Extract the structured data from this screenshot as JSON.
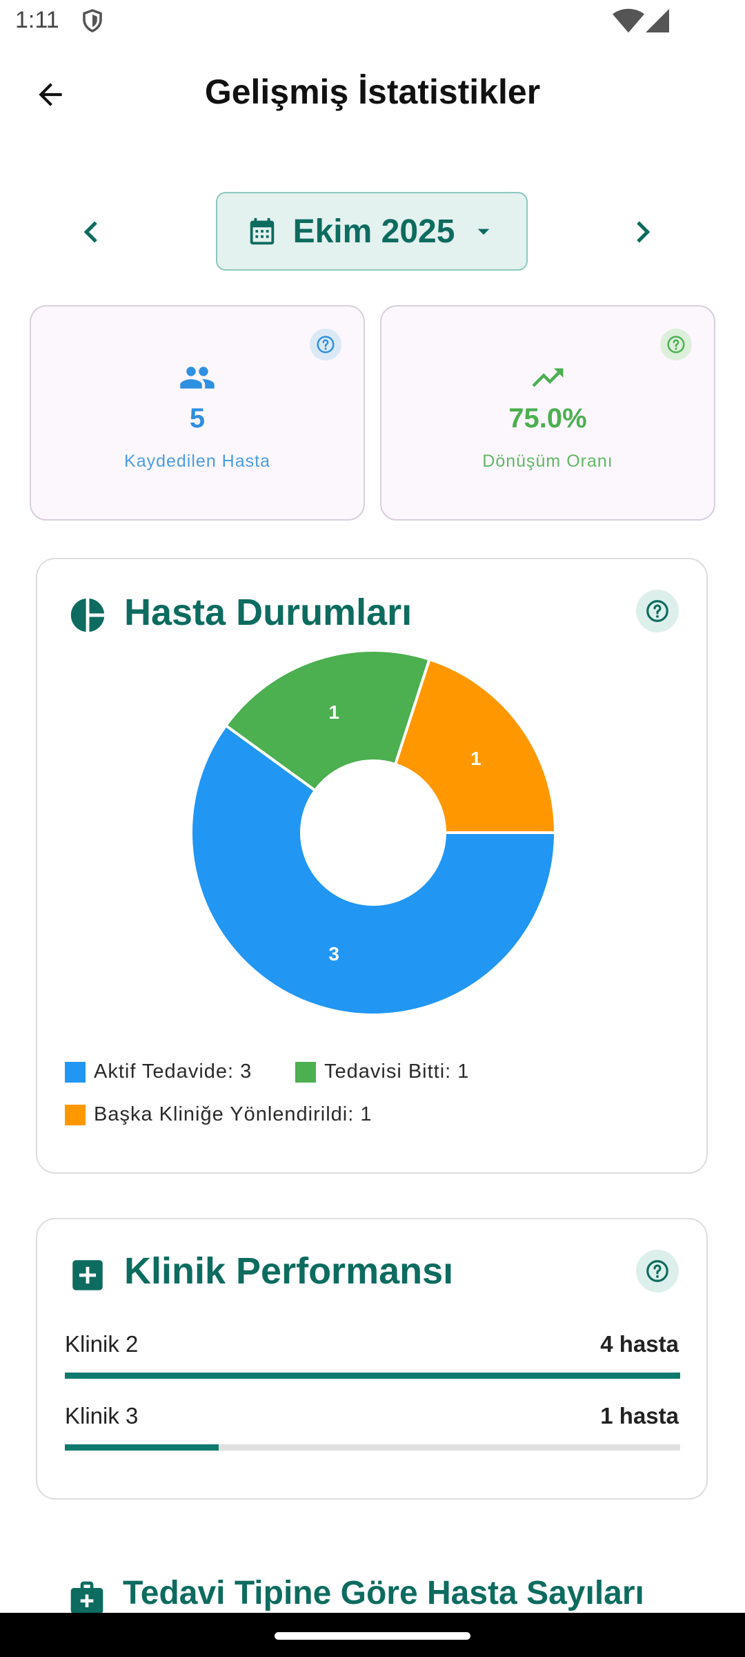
{
  "status_bar": {
    "time": "1:11"
  },
  "header": {
    "title": "Gelişmiş İstatistikler"
  },
  "month_selector": {
    "label": "Ekim 2025"
  },
  "stats": [
    {
      "value": "5",
      "label": "Kaydedilen Hasta",
      "color": "#2f8fe0"
    },
    {
      "value": "75.0%",
      "label": "Dönüşüm Oranı",
      "color": "#4caf50"
    }
  ],
  "status_section": {
    "title": "Hasta Durumları",
    "chart_data": {
      "type": "pie",
      "categories": [
        "Aktif Tedavide",
        "Tedavisi Bitti",
        "Başka Kliniğe Yönlendirildi"
      ],
      "values": [
        3,
        1,
        1
      ],
      "colors": [
        "#2196f3",
        "#4caf50",
        "#ff9800"
      ]
    },
    "legend": [
      {
        "label": "Aktif Tedavide: 3",
        "color": "#2196f3"
      },
      {
        "label": "Tedavisi Bitti: 1",
        "color": "#4caf50"
      },
      {
        "label": "Başka Kliniğe Yönlendirildi: 1",
        "color": "#ff9800"
      }
    ]
  },
  "clinic_section": {
    "title": "Klinik Performansı",
    "rows": [
      {
        "name": "Klinik 2",
        "value": "4 hasta",
        "fraction": 1.0
      },
      {
        "name": "Klinik 3",
        "value": "1 hasta",
        "fraction": 0.25
      }
    ]
  },
  "treatment_section": {
    "title": "Tedavi Tipine Göre Hasta Sayıları"
  },
  "colors": {
    "primary": "#0d6b5f",
    "accent_bar": "#0d7a6c"
  }
}
